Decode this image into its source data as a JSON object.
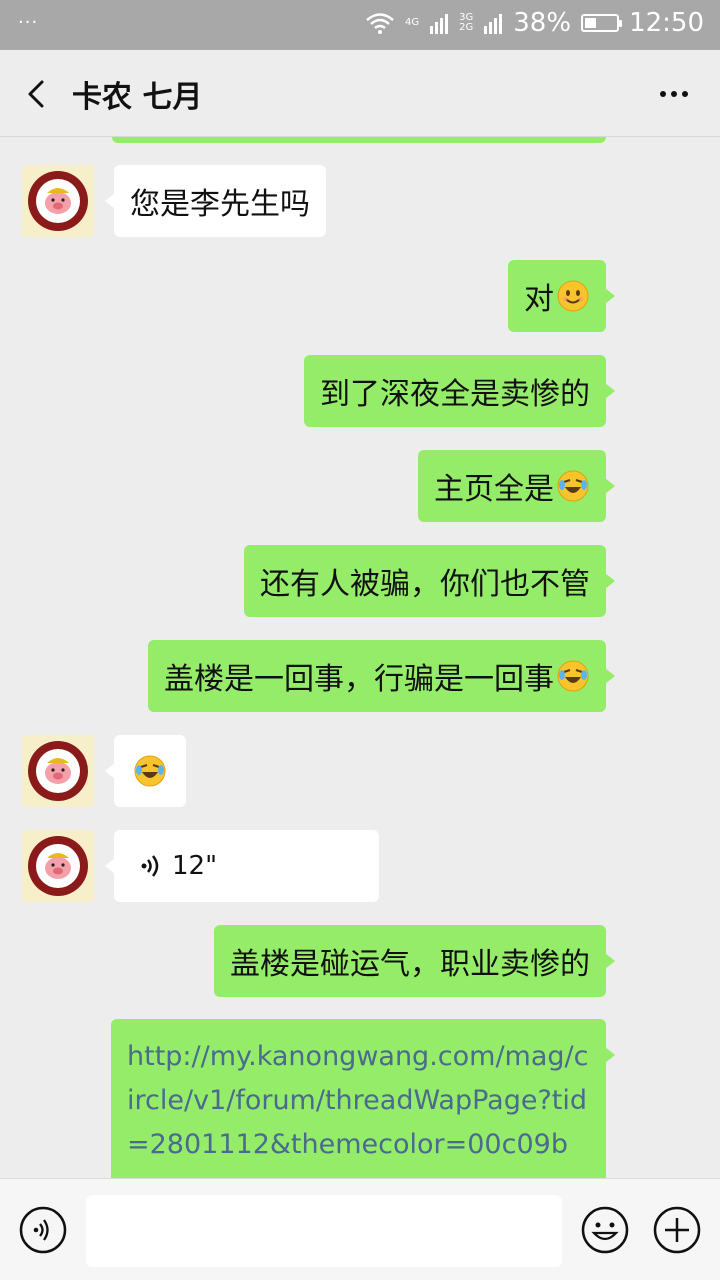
{
  "status_bar": {
    "notif": "···",
    "net_top": "4G",
    "net_a": "3G",
    "net_b": "2G",
    "battery": "38%",
    "battery_level": 0.38,
    "time": "12:50"
  },
  "header": {
    "title": "卡农 七月"
  },
  "messages": [
    {
      "side": "left",
      "text": "您是李先生吗"
    },
    {
      "side": "right",
      "text": "对",
      "emoji": "smile-emoji"
    },
    {
      "side": "right",
      "text": "到了深夜全是卖惨的"
    },
    {
      "side": "right",
      "text": "主页全是",
      "emoji": "rofl-emoji"
    },
    {
      "side": "right",
      "text": "还有人被骗，你们也不管"
    },
    {
      "side": "right",
      "text": "盖楼是一回事，行骗是一回事",
      "emoji": "rofl-emoji"
    },
    {
      "side": "left",
      "text": "",
      "emoji": "rofl-emoji"
    },
    {
      "side": "left",
      "voice_duration": "12\""
    },
    {
      "side": "right",
      "text": "盖楼是碰运气，职业卖惨的"
    },
    {
      "side": "right",
      "link": "http://my.kanongwang.com/mag/circle/v1/forum/threadWapPage?tid=2801112&themecolor=00c09b"
    }
  ],
  "avatar_text": "HAMICAT LOVE PIG",
  "input": {
    "placeholder": "",
    "value": ""
  },
  "colors": {
    "bubble_right": "#95ec69",
    "bubble_left": "#ffffff",
    "background": "#ededed",
    "link": "#4a6a8f"
  }
}
